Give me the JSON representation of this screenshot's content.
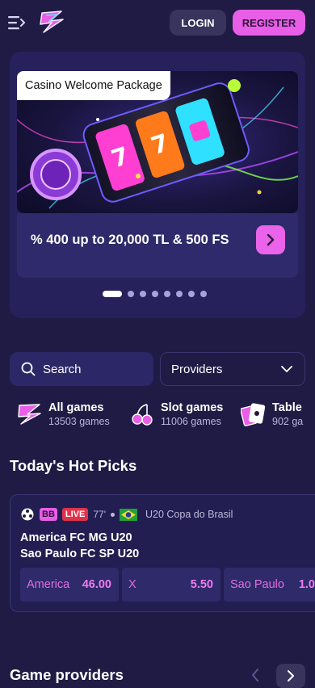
{
  "header": {
    "login_label": "LOGIN",
    "register_label": "REGISTER"
  },
  "banner": {
    "tag": "Casino Welcome Package",
    "promo": "% 400 up to 20,000 TL & 500 FS",
    "slides": 8,
    "active_slide": 1
  },
  "filters": {
    "search_label": "Search",
    "providers_label": "Providers"
  },
  "categories": [
    {
      "name": "All games",
      "count": "13503 games",
      "icon": "all-games-icon"
    },
    {
      "name": "Slot games",
      "count": "11006 games",
      "icon": "cherries-icon"
    },
    {
      "name": "Table",
      "count": "902 ga",
      "icon": "cards-icon"
    }
  ],
  "hot_picks": {
    "title": "Today's Hot Picks",
    "match": {
      "sport_badge": "BB",
      "live_badge": "LIVE",
      "minute": "77'",
      "league": "U20 Copa do Brasil",
      "home": "America FC MG U20",
      "away": "Sao Paulo FC SP U20",
      "odds": [
        {
          "label": "America",
          "value": "46.00"
        },
        {
          "label": "X",
          "value": "5.50"
        },
        {
          "label": "Sao Paulo",
          "value": "1.0"
        }
      ]
    }
  },
  "providers_section": {
    "title": "Game providers"
  },
  "colors": {
    "background": "#1f1b45",
    "accent": "#e85ee6",
    "card": "#2c2766",
    "live": "#e0334a"
  }
}
